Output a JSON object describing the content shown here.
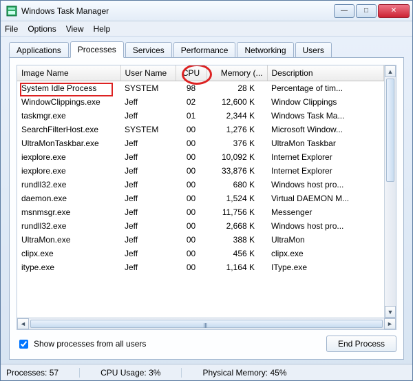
{
  "window": {
    "title": "Windows Task Manager"
  },
  "menu": {
    "file": "File",
    "options": "Options",
    "view": "View",
    "help": "Help"
  },
  "tabs": {
    "applications": "Applications",
    "processes": "Processes",
    "services": "Services",
    "performance": "Performance",
    "networking": "Networking",
    "users": "Users",
    "active": "processes"
  },
  "columns": {
    "image": "Image Name",
    "user": "User Name",
    "cpu": "CPU",
    "memory": "Memory (...",
    "desc": "Description"
  },
  "rows": [
    {
      "image": "System Idle Process",
      "user": "SYSTEM",
      "cpu": "98",
      "mem": "28 K",
      "desc": "Percentage of tim..."
    },
    {
      "image": "WindowClippings.exe",
      "user": "Jeff",
      "cpu": "02",
      "mem": "12,600 K",
      "desc": "Window Clippings"
    },
    {
      "image": "taskmgr.exe",
      "user": "Jeff",
      "cpu": "01",
      "mem": "2,344 K",
      "desc": "Windows Task Ma..."
    },
    {
      "image": "SearchFilterHost.exe",
      "user": "SYSTEM",
      "cpu": "00",
      "mem": "1,276 K",
      "desc": "Microsoft Window..."
    },
    {
      "image": "UltraMonTaskbar.exe",
      "user": "Jeff",
      "cpu": "00",
      "mem": "376 K",
      "desc": "UltraMon Taskbar"
    },
    {
      "image": "iexplore.exe",
      "user": "Jeff",
      "cpu": "00",
      "mem": "10,092 K",
      "desc": "Internet Explorer"
    },
    {
      "image": "iexplore.exe",
      "user": "Jeff",
      "cpu": "00",
      "mem": "33,876 K",
      "desc": "Internet Explorer"
    },
    {
      "image": "rundll32.exe",
      "user": "Jeff",
      "cpu": "00",
      "mem": "680 K",
      "desc": "Windows host pro..."
    },
    {
      "image": "daemon.exe",
      "user": "Jeff",
      "cpu": "00",
      "mem": "1,524 K",
      "desc": "Virtual DAEMON M..."
    },
    {
      "image": "msnmsgr.exe",
      "user": "Jeff",
      "cpu": "00",
      "mem": "11,756 K",
      "desc": "Messenger"
    },
    {
      "image": "rundll32.exe",
      "user": "Jeff",
      "cpu": "00",
      "mem": "2,668 K",
      "desc": "Windows host pro..."
    },
    {
      "image": "UltraMon.exe",
      "user": "Jeff",
      "cpu": "00",
      "mem": "388 K",
      "desc": "UltraMon"
    },
    {
      "image": "clipx.exe",
      "user": "Jeff",
      "cpu": "00",
      "mem": "456 K",
      "desc": "clipx.exe"
    },
    {
      "image": "itype.exe",
      "user": "Jeff",
      "cpu": "00",
      "mem": "1,164 K",
      "desc": "IType.exe"
    }
  ],
  "checkbox": {
    "label": "Show processes from all users",
    "checked": true
  },
  "buttons": {
    "end_process": "End Process"
  },
  "status": {
    "processes_label": "Processes:",
    "processes_value": "57",
    "cpu_label": "CPU Usage:",
    "cpu_value": "3%",
    "mem_label": "Physical Memory:",
    "mem_value": "45%"
  }
}
